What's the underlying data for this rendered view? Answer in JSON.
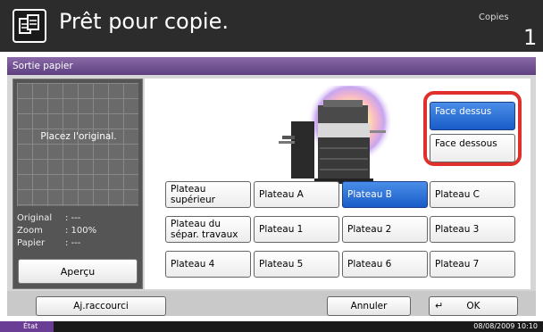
{
  "header": {
    "title": "Prêt pour copie.",
    "copies_label": "Copies",
    "copies_count": "1"
  },
  "panel": {
    "title": "Sortie papier"
  },
  "preview": {
    "place_original": "Placez l'original.",
    "info": [
      {
        "key": "Original",
        "value": ": ---"
      },
      {
        "key": "Zoom",
        "value": ": 100%"
      },
      {
        "key": "Papier",
        "value": ": ---"
      }
    ],
    "apercu_label": "Aperçu"
  },
  "face_options": [
    {
      "label": "Face dessus",
      "selected": true
    },
    {
      "label": "Face dessous",
      "selected": false
    }
  ],
  "trays": [
    [
      {
        "label": "Plateau supérieur",
        "selected": false
      },
      {
        "label": "Plateau A",
        "selected": false
      },
      {
        "label": "Plateau B",
        "selected": true
      },
      {
        "label": "Plateau C",
        "selected": false
      }
    ],
    [
      {
        "label": "Plateau du sépar. travaux",
        "selected": false
      },
      {
        "label": "Plateau 1",
        "selected": false
      },
      {
        "label": "Plateau 2",
        "selected": false
      },
      {
        "label": "Plateau 3",
        "selected": false
      }
    ],
    [
      {
        "label": "Plateau 4",
        "selected": false
      },
      {
        "label": "Plateau 5",
        "selected": false
      },
      {
        "label": "Plateau 6",
        "selected": false
      },
      {
        "label": "Plateau 7",
        "selected": false
      }
    ]
  ],
  "bottom": {
    "shortcut_label": "Aj.raccourci",
    "cancel_label": "Annuler",
    "ok_label": "OK"
  },
  "status": {
    "state_label": "État",
    "datetime": "08/08/2009  10:10"
  },
  "colors": {
    "accent_selected": "#1a5cc8",
    "title_bar": "#6a3e94",
    "highlight_ring": "#e0302c"
  },
  "icons": {
    "header": "copy-icon",
    "ok": "enter-icon"
  }
}
